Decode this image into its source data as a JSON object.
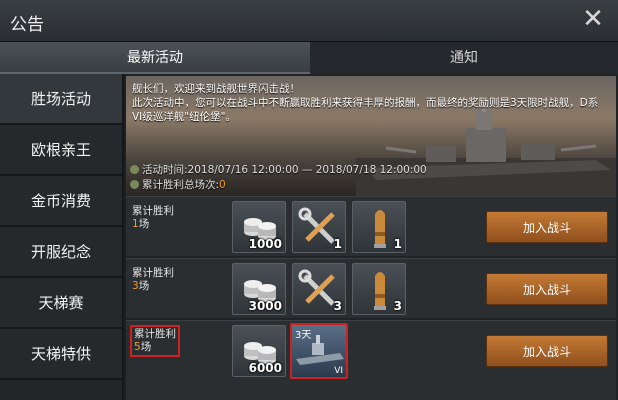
{
  "window": {
    "title": "公告"
  },
  "tabs": [
    {
      "label": "最新活动",
      "active": true
    },
    {
      "label": "通知",
      "active": false
    }
  ],
  "sidebar": {
    "items": [
      {
        "label": "胜场活动",
        "active": true
      },
      {
        "label": "欧根亲王",
        "active": false
      },
      {
        "label": "金币消费",
        "active": false
      },
      {
        "label": "开服纪念",
        "active": false
      },
      {
        "label": "天梯赛",
        "active": false
      },
      {
        "label": "天梯特供",
        "active": false
      }
    ]
  },
  "banner": {
    "intro": "舰长们，欢迎来到战舰世界闪击战！\n此次活动中，您可以在战斗中不断赢取胜利来获得丰厚的报酬，而最终的奖励则是3天限时战舰，D系VI级巡洋舰\"纽伦堡\"。",
    "time_label": "活动时间:2018/07/16 12:00:00 — 2018/07/18 12:00:00",
    "count_label": "累计胜利总场次:",
    "count_value": "0"
  },
  "rewards": [
    {
      "label": "累计胜利",
      "count": "1",
      "unit": "场",
      "items": [
        {
          "icon": "silver-coins-icon",
          "qty": "1000"
        },
        {
          "icon": "tools-icon",
          "qty": "1"
        },
        {
          "icon": "shell-icon",
          "qty": "1"
        }
      ],
      "button": "加入战斗"
    },
    {
      "label": "累计胜利",
      "count": "3",
      "unit": "场",
      "items": [
        {
          "icon": "silver-coins-icon",
          "qty": "3000"
        },
        {
          "icon": "tools-icon",
          "qty": "3"
        },
        {
          "icon": "shell-icon",
          "qty": "3"
        }
      ],
      "button": "加入战斗"
    },
    {
      "label": "累计胜利",
      "count": "5",
      "unit": "场",
      "highlighted": true,
      "items": [
        {
          "icon": "silver-coins-icon",
          "qty": "6000"
        },
        {
          "icon": "ship-icon",
          "tier": "3天",
          "tag": "VI"
        }
      ],
      "button": "加入战斗"
    }
  ],
  "colors": {
    "accent": "#f39a2a",
    "highlight": "#d02020",
    "button": "#b06a2c"
  }
}
